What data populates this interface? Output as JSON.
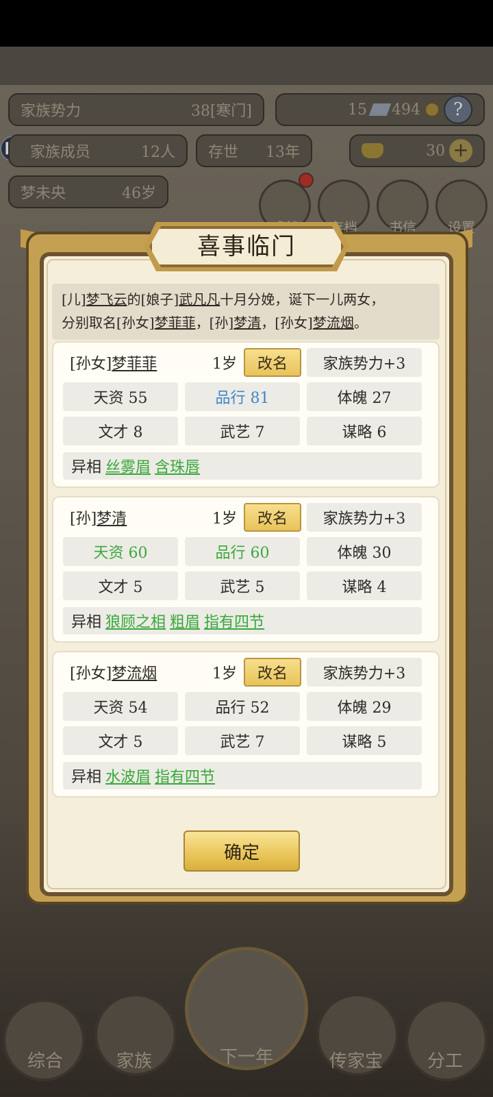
{
  "background": {
    "family_power_label": "家族势力",
    "family_power_value": "38[寒门]",
    "gems": "15",
    "coins": "494",
    "help": "?",
    "members_label": "家族成员",
    "members_value": "12人",
    "exist_label": "存世",
    "exist_value": "13年",
    "gold": "30",
    "plus": "+",
    "patriarch_name": "梦未央",
    "patriarch_age": "46岁",
    "round_buttons": [
      "成就",
      "存档",
      "书信",
      "设置"
    ],
    "nav": [
      "综合",
      "家族",
      "下一年",
      "传家宝",
      "分工"
    ]
  },
  "modal": {
    "title": "喜事临门",
    "announce": {
      "p1": "[儿]",
      "n1": "梦飞云",
      "p2": "的[娘子]",
      "n2": "武凡凡",
      "p3": "十月分娩，诞下一儿两女，",
      "p4": "分别取名[孙女]",
      "n3": "梦菲菲",
      "p5": "，[孙]",
      "n4": "梦清",
      "p6": "，[孙女]",
      "n5": "梦流烟",
      "p7": "。"
    },
    "rename_label": "改名",
    "trait_label": "异相",
    "confirm_label": "确定",
    "children": [
      {
        "prefix": "[孙女]",
        "name": "梦菲菲",
        "age": "1岁",
        "power": "家族势力+3",
        "talent": "天资 55",
        "conduct": "品行 81",
        "physique": "体魄 27",
        "letters": "文才 8",
        "martial": "武艺 7",
        "strategy": "谋略 6",
        "traits": [
          "丝雾眉",
          "含珠唇"
        ]
      },
      {
        "prefix": "[孙]",
        "name": "梦清",
        "age": "1岁",
        "power": "家族势力+3",
        "talent": "天资 60",
        "conduct": "品行 60",
        "physique": "体魄 30",
        "letters": "文才 5",
        "martial": "武艺 5",
        "strategy": "谋略 4",
        "traits": [
          "狼顾之相",
          "粗眉",
          "指有四节"
        ]
      },
      {
        "prefix": "[孙女]",
        "name": "梦流烟",
        "age": "1岁",
        "power": "家族势力+3",
        "talent": "天资 54",
        "conduct": "品行 52",
        "physique": "体魄 29",
        "letters": "文才 5",
        "martial": "武艺 7",
        "strategy": "谋略 5",
        "traits": [
          "水波眉",
          "指有四节"
        ]
      }
    ]
  },
  "colors": {
    "high_stat_blue": "#3e86c8",
    "high_stat_green": "#3aa83a",
    "trait_green": "#3aa83a",
    "button_gold": "#e8c35a"
  }
}
